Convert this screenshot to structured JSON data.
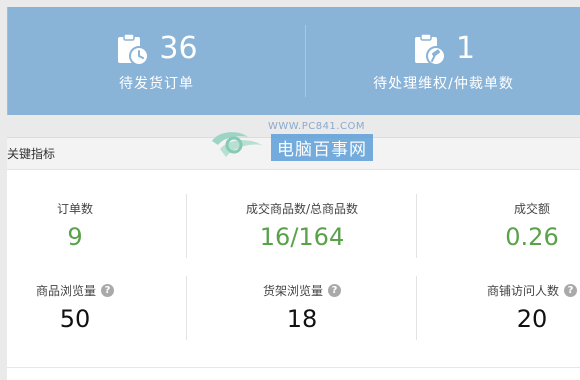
{
  "banner": {
    "left": {
      "value": "36",
      "label": "待发货订单",
      "icon": "clipboard-clock-icon"
    },
    "right": {
      "value": "1",
      "label": "待处理维权/仲裁单数",
      "icon": "clipboard-gavel-icon"
    },
    "background_color": "#8ab3d8"
  },
  "watermark": {
    "url": "WWW.PC841.COM",
    "name": "电脑百事网"
  },
  "key_metrics": {
    "title": "关键指标",
    "row1": [
      {
        "label": "订单数",
        "value": "9"
      },
      {
        "label": "成交商品数/总商品数",
        "value": "16/164"
      },
      {
        "label": "成交额",
        "value": "0.26"
      }
    ],
    "row2": [
      {
        "label": "商品浏览量",
        "value": "50",
        "help": "?"
      },
      {
        "label": "货架浏览量",
        "value": "18",
        "help": "?"
      },
      {
        "label": "商铺访问人数",
        "value": "20",
        "help": "?"
      }
    ],
    "value_color_green": "#5aa14a"
  }
}
